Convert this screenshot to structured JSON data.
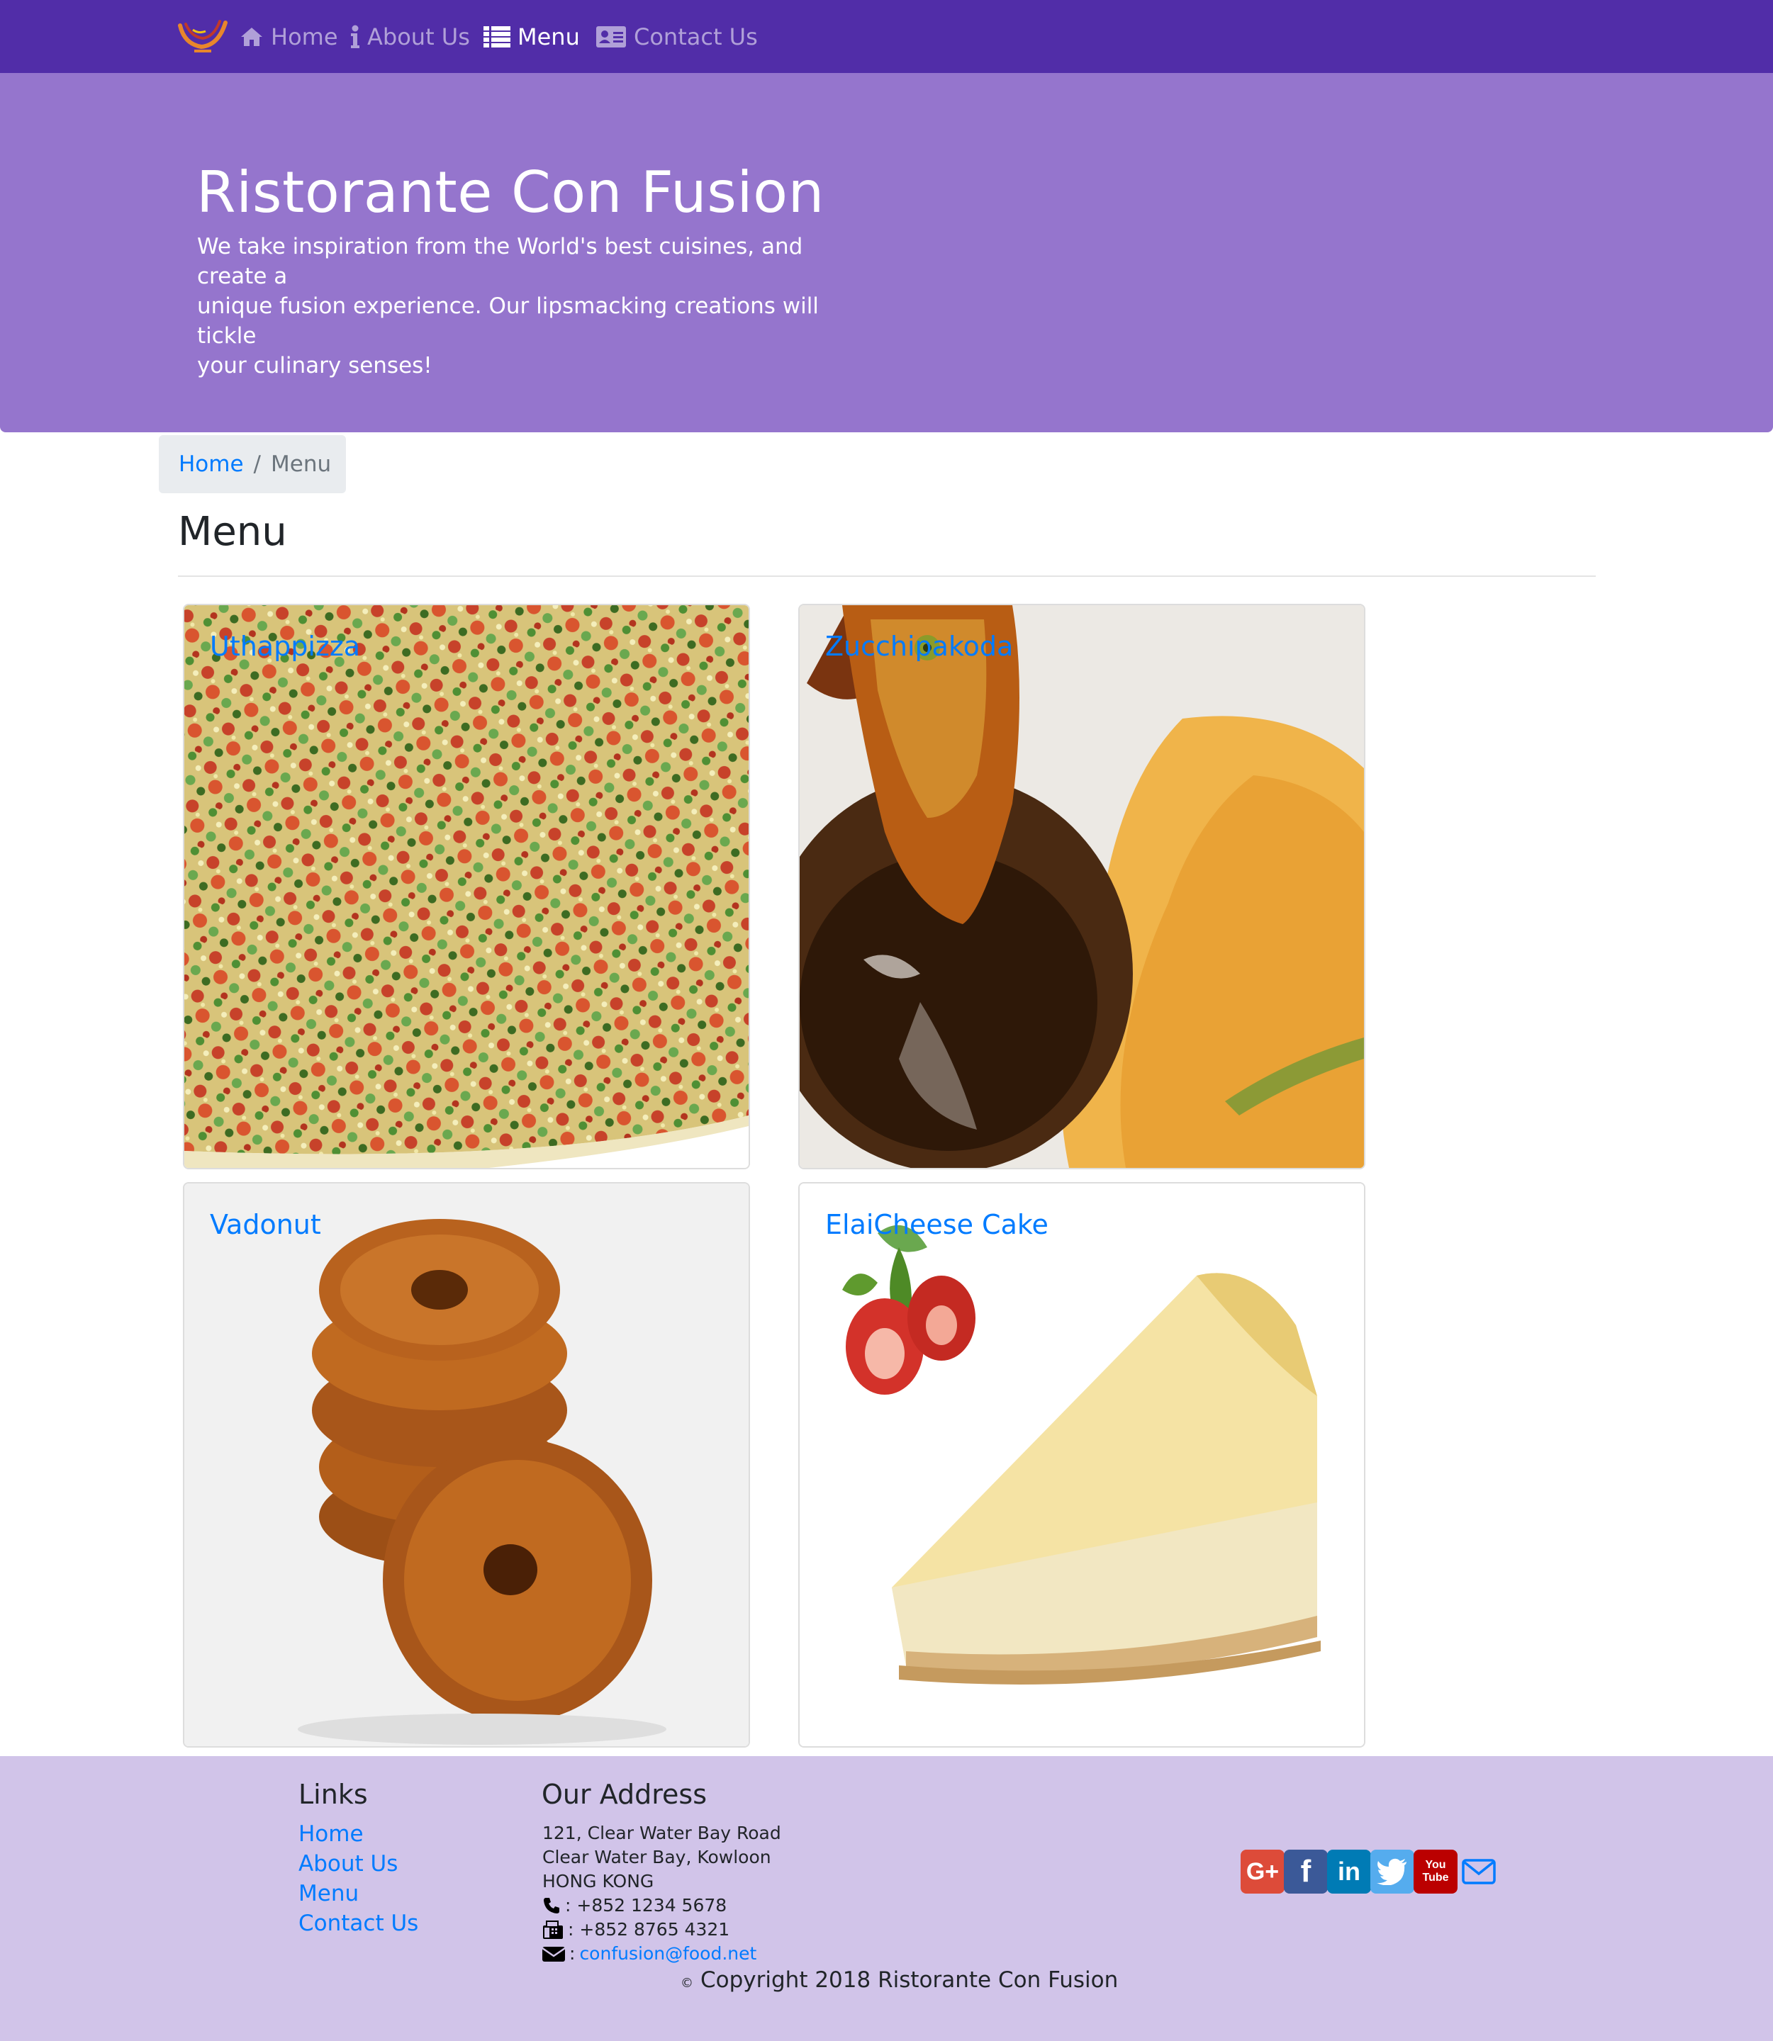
{
  "nav": {
    "logo_icon": "restaurant-logo",
    "items": [
      {
        "label": "Home",
        "icon": "home-icon",
        "active": false
      },
      {
        "label": "About Us",
        "icon": "info-icon",
        "active": false
      },
      {
        "label": "Menu",
        "icon": "list-icon",
        "active": true
      },
      {
        "label": "Contact Us",
        "icon": "address-card-icon",
        "active": false
      }
    ]
  },
  "jumbotron": {
    "title": "Ristorante Con Fusion",
    "line1": "We take inspiration from the World's best cuisines, and create a",
    "line2": "unique fusion experience. Our lipsmacking creations will tickle",
    "line3": "your culinary senses!"
  },
  "breadcrumb": {
    "home": "Home",
    "separator": "/",
    "current": "Menu"
  },
  "page": {
    "heading": "Menu"
  },
  "dishes": [
    {
      "name": "Uthappizza",
      "image": "pizza-photo"
    },
    {
      "name": "Zucchipakoda",
      "image": "pakoda-photo"
    },
    {
      "name": "Vadonut",
      "image": "vadonut-photo"
    },
    {
      "name": "ElaiCheese Cake",
      "image": "cheesecake-photo"
    }
  ],
  "footer": {
    "links_heading": "Links",
    "links": [
      "Home",
      "About Us",
      "Menu",
      "Contact Us"
    ],
    "address_heading": "Our Address",
    "address_line1": "121, Clear Water Bay Road",
    "address_line2": "Clear Water Bay, Kowloon",
    "address_line3": "HONG KONG",
    "phone": ": +852 1234 5678",
    "fax": ": +852 8765 4321",
    "email_prefix": ":",
    "email": "confusion@food.net",
    "copyright_symbol": "©",
    "copyright": "Copyright 2018 Ristorante Con Fusion",
    "social": [
      {
        "icon": "google-plus-icon",
        "color": "#dd4b39",
        "glyph": "G+"
      },
      {
        "icon": "facebook-icon",
        "color": "#3b5998",
        "glyph": "f"
      },
      {
        "icon": "linkedin-icon",
        "color": "#007bb5",
        "glyph": "in"
      },
      {
        "icon": "twitter-icon",
        "color": "#55acee",
        "glyph": ""
      },
      {
        "icon": "youtube-icon",
        "color": "#bb0000",
        "glyph": "You Tube"
      },
      {
        "icon": "mail-icon",
        "color": "#007bff",
        "glyph": ""
      }
    ]
  },
  "colors": {
    "navbar": "#512da8",
    "jumbotron": "#9575cd",
    "footer": "#d1c4e9",
    "link": "#007bff"
  }
}
